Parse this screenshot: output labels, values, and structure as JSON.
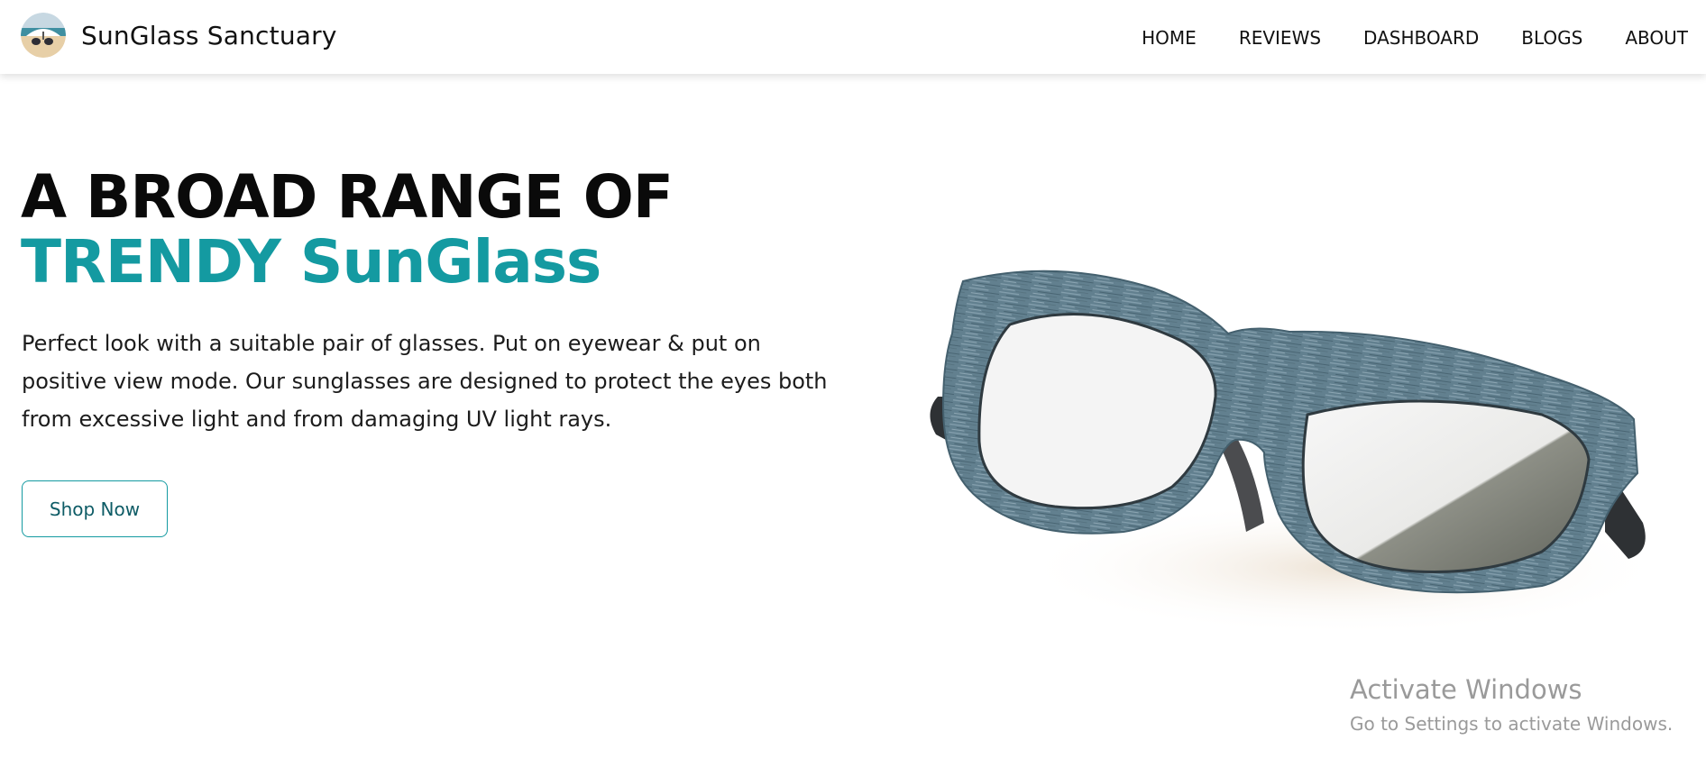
{
  "brand": {
    "name": "SunGlass Sanctuary",
    "logo_icon": "beach-umbrella-logo"
  },
  "nav": {
    "items": [
      {
        "label": "HOME"
      },
      {
        "label": "REVIEWS"
      },
      {
        "label": "DASHBOARD"
      },
      {
        "label": "BLOGS"
      },
      {
        "label": "ABOUT"
      }
    ]
  },
  "hero": {
    "heading_line1": "A BROAD RANGE OF",
    "heading_line2": "TRENDY SunGlass",
    "description": "Perfect look with a suitable pair of glasses. Put on eyewear & put on positive view mode. Our sunglasses are designed to protect the eyes both from excessive light and from damaging UV light rays.",
    "button_label": "Shop Now",
    "image_icon": "sunglasses-illustration"
  },
  "watermark": {
    "title": "Activate Windows",
    "subtitle": "Go to Settings to activate Windows."
  },
  "colors": {
    "accent": "#149aa1",
    "button_text": "#0e5c66",
    "frame": "#5e7d8d",
    "heading": "#0a0a0a"
  }
}
